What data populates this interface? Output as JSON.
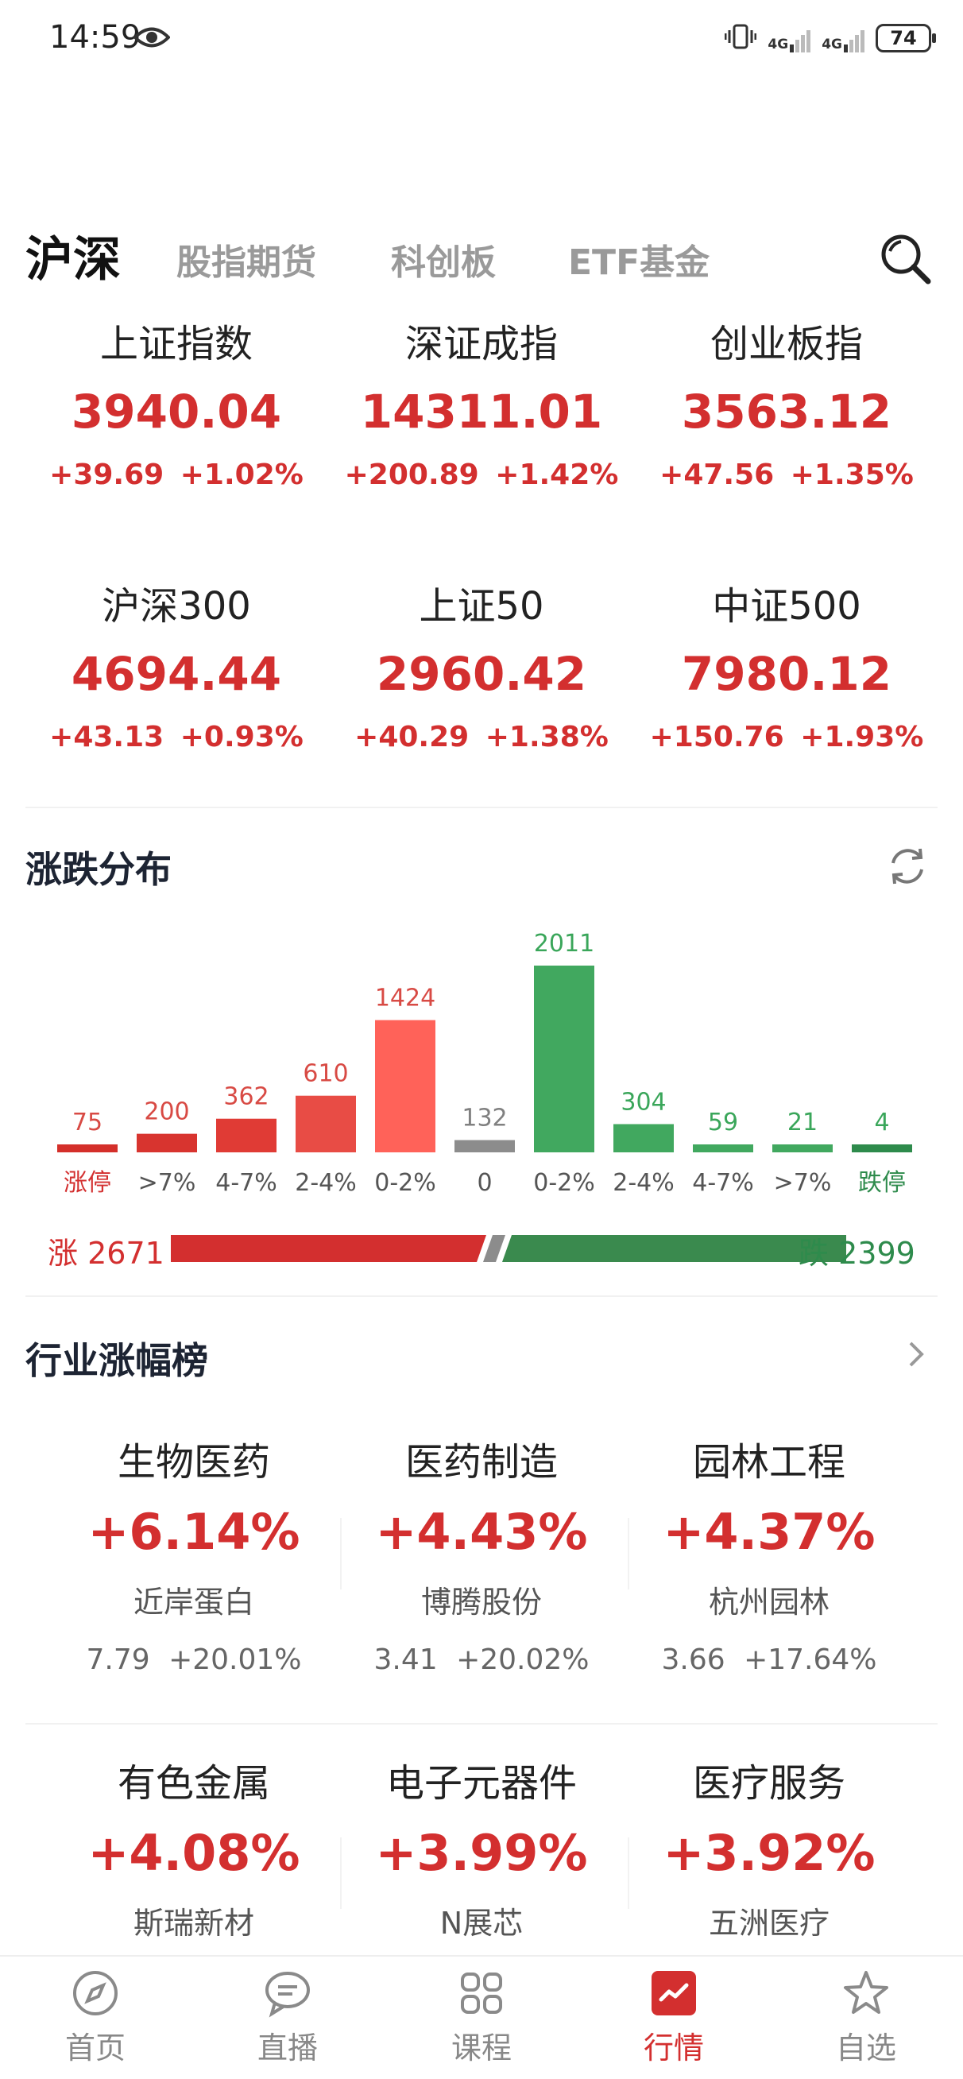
{
  "status_bar": {
    "time": "14:59",
    "battery": "74",
    "network1": "4G",
    "network2": "4G"
  },
  "tabs": [
    "沪深",
    "股指期货",
    "科创板",
    "ETF基金"
  ],
  "indices": [
    {
      "name": "上证指数",
      "value": "3940.04",
      "change": "+39.69",
      "pct": "+1.02%"
    },
    {
      "name": "深证成指",
      "value": "14311.01",
      "change": "+200.89",
      "pct": "+1.42%"
    },
    {
      "name": "创业板指",
      "value": "3563.12",
      "change": "+47.56",
      "pct": "+1.35%"
    },
    {
      "name": "沪深300",
      "value": "4694.44",
      "change": "+43.13",
      "pct": "+0.93%"
    },
    {
      "name": "上证50",
      "value": "2960.42",
      "change": "+40.29",
      "pct": "+1.38%"
    },
    {
      "name": "中证500",
      "value": "7980.12",
      "change": "+150.76",
      "pct": "+1.93%"
    }
  ],
  "distribution": {
    "title": "涨跌分布",
    "up_label": "涨",
    "up_count": "2671",
    "down_label": "跌",
    "down_count": "2399",
    "colors": {
      "limit_up": "#d42f2a",
      "up_dark": "#e03b35",
      "up_mid": "#e84c45",
      "up_light": "#ff6259",
      "flat": "#8c8c8c",
      "down": "#3aa65a"
    }
  },
  "chart_data": {
    "type": "bar",
    "categories": [
      "涨停",
      ">7%",
      "4-7%",
      "2-4%",
      "0-2%",
      "0",
      "0-2%",
      "2-4%",
      "4-7%",
      ">7%",
      "跌停"
    ],
    "values": [
      75,
      200,
      362,
      610,
      1424,
      132,
      2011,
      304,
      59,
      21,
      4
    ],
    "series_colors": [
      "#d42f2a",
      "#d8342f",
      "#e03b35",
      "#e84c45",
      "#ff6259",
      "#8c8c8c",
      "#41a85f",
      "#41a85f",
      "#41a85f",
      "#41a85f",
      "#2e8b4c"
    ]
  },
  "industries": {
    "title": "行业涨幅榜",
    "items": [
      {
        "name": "生物医药",
        "pct": "+6.14%",
        "stock": "近岸蛋白",
        "price": "7.79",
        "stock_pct": "+20.01%"
      },
      {
        "name": "医药制造",
        "pct": "+4.43%",
        "stock": "博腾股份",
        "price": "3.41",
        "stock_pct": "+20.02%"
      },
      {
        "name": "园林工程",
        "pct": "+4.37%",
        "stock": "杭州园林",
        "price": "3.66",
        "stock_pct": "+17.64%"
      },
      {
        "name": "有色金属",
        "pct": "+4.08%",
        "stock": "斯瑞新材",
        "price": "",
        "stock_pct": ""
      },
      {
        "name": "电子元器件",
        "pct": "+3.99%",
        "stock": "N展芯",
        "price": "",
        "stock_pct": ""
      },
      {
        "name": "医疗服务",
        "pct": "+3.92%",
        "stock": "五洲医疗",
        "price": "",
        "stock_pct": ""
      }
    ]
  },
  "bottom_nav": [
    {
      "label": "首页",
      "icon": "compass-icon"
    },
    {
      "label": "直播",
      "icon": "chat-icon"
    },
    {
      "label": "课程",
      "icon": "grid-icon"
    },
    {
      "label": "行情",
      "icon": "market-icon"
    },
    {
      "label": "自选",
      "icon": "star-icon"
    }
  ]
}
